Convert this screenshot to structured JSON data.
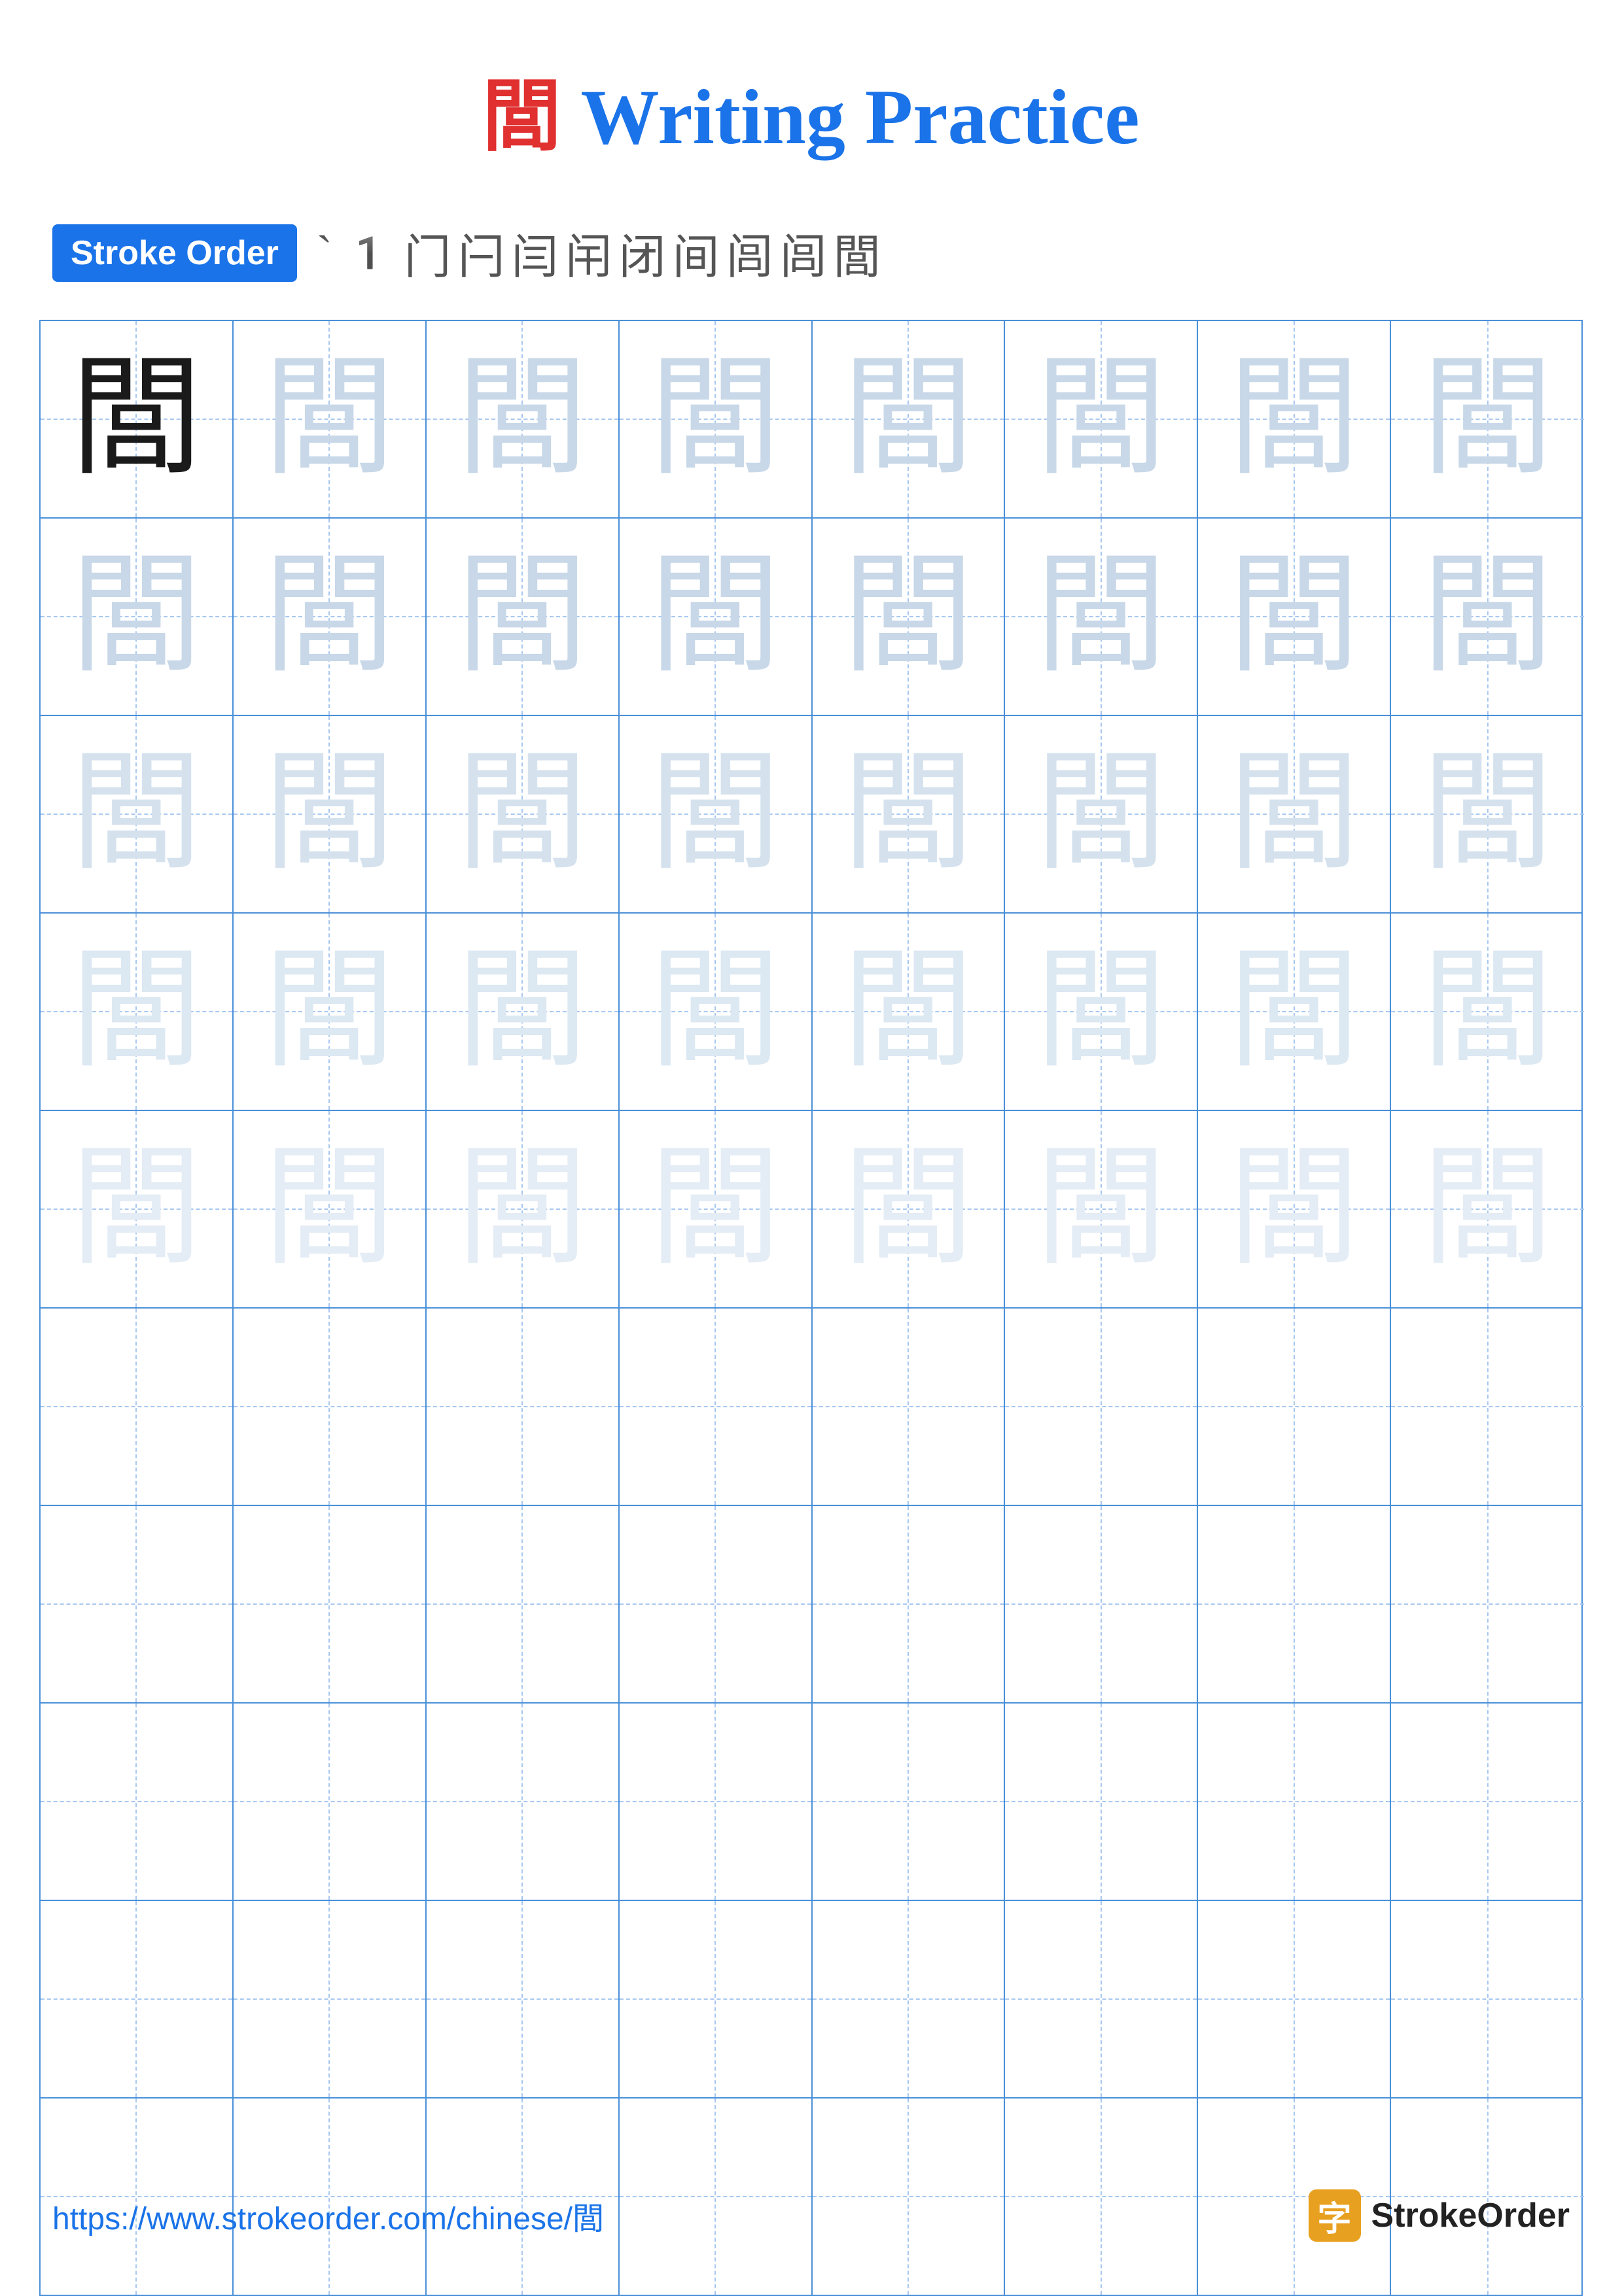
{
  "title": {
    "chinese": "閭",
    "english": "Writing Practice"
  },
  "stroke_order": {
    "badge_label": "Stroke Order",
    "strokes": [
      "`",
      "㇀",
      "门",
      "闩",
      "闫",
      "闬",
      "闭",
      "间",
      "闾",
      "闾",
      "閭"
    ]
  },
  "grid": {
    "rows": 10,
    "cols": 8,
    "character": "閭",
    "filled_rows": 5,
    "empty_rows": 5
  },
  "footer": {
    "url": "https://www.strokeorder.com/chinese/閭",
    "brand_icon": "字",
    "brand_name": "StrokeOrder"
  }
}
